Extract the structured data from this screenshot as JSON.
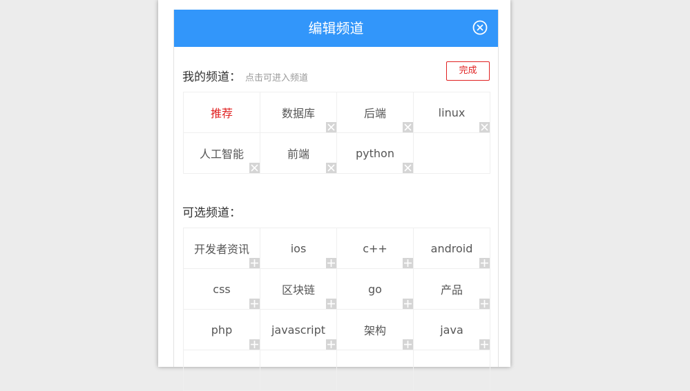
{
  "modal": {
    "title": "编辑频道"
  },
  "my_channels": {
    "title": "我的频道：",
    "hint": "点击可进入频道",
    "done_label": "完成",
    "items": [
      {
        "label": "推荐",
        "active": true
      },
      {
        "label": "数据库"
      },
      {
        "label": "后端"
      },
      {
        "label": "linux"
      },
      {
        "label": "人工智能"
      },
      {
        "label": "前端"
      },
      {
        "label": "python"
      }
    ]
  },
  "available_channels": {
    "title": "可选频道：",
    "items": [
      {
        "label": "开发者资讯"
      },
      {
        "label": "ios"
      },
      {
        "label": "c++"
      },
      {
        "label": "android"
      },
      {
        "label": "css"
      },
      {
        "label": "区块链"
      },
      {
        "label": "go"
      },
      {
        "label": "产品"
      },
      {
        "label": "php"
      },
      {
        "label": "javascript"
      },
      {
        "label": "架构"
      },
      {
        "label": "java"
      }
    ]
  },
  "colors": {
    "header": "#3296fa",
    "active": "#e02020",
    "badge": "#d5d5d5"
  },
  "icons": {
    "close": "close-circle-icon",
    "remove": "remove-x-icon",
    "add": "add-plus-icon"
  }
}
